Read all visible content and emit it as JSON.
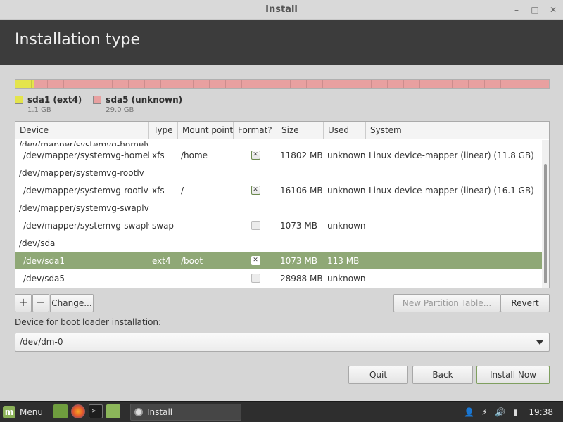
{
  "window": {
    "title": "Install",
    "page_title": "Installation type"
  },
  "partition_bar": {
    "segments": [
      {
        "name": "sda1 (ext4)",
        "size": "1.1 GB",
        "color": "#e4e44c",
        "fraction": 0.036
      },
      {
        "name": "sda5 (unknown)",
        "size": "29.0 GB",
        "color": "#e8a0a0",
        "fraction": 0.964
      }
    ]
  },
  "table": {
    "headers": {
      "device": "Device",
      "type": "Type",
      "mount": "Mount point",
      "format": "Format?",
      "size": "Size",
      "used": "Used",
      "system": "System"
    },
    "cut_row": "/dev/mapper/systemvg-homelv",
    "rows": [
      {
        "kind": "part",
        "device": "/dev/mapper/systemvg-homelv",
        "type": "xfs",
        "mount": "/home",
        "format": "checked",
        "size": "11802 MB",
        "used": "unknown",
        "system": "Linux device-mapper (linear) (11.8 GB)"
      },
      {
        "kind": "parent",
        "device": "/dev/mapper/systemvg-rootlv"
      },
      {
        "kind": "part",
        "device": "/dev/mapper/systemvg-rootlv",
        "type": "xfs",
        "mount": "/",
        "format": "checked",
        "size": "16106 MB",
        "used": "unknown",
        "system": "Linux device-mapper (linear) (16.1 GB)"
      },
      {
        "kind": "parent",
        "device": "/dev/mapper/systemvg-swaplv"
      },
      {
        "kind": "part",
        "device": "/dev/mapper/systemvg-swaplv",
        "type": "swap",
        "mount": "",
        "format": "unchecked",
        "size": "1073 MB",
        "used": "unknown",
        "system": ""
      },
      {
        "kind": "parent",
        "device": "/dev/sda"
      },
      {
        "kind": "part",
        "selected": true,
        "device": "/dev/sda1",
        "type": "ext4",
        "mount": "/boot",
        "format": "checked",
        "size": "1073 MB",
        "used": "113 MB",
        "system": ""
      },
      {
        "kind": "part",
        "device": "/dev/sda5",
        "type": "",
        "mount": "",
        "format": "unchecked",
        "size": "28988 MB",
        "used": "unknown",
        "system": ""
      }
    ]
  },
  "toolbar": {
    "add": "+",
    "remove": "−",
    "change": "Change...",
    "new_table": "New Partition Table...",
    "revert": "Revert"
  },
  "boot_loader": {
    "label": "Device for boot loader installation:",
    "value": "/dev/dm-0"
  },
  "buttons": {
    "quit": "Quit",
    "back": "Back",
    "install": "Install Now"
  },
  "taskbar": {
    "menu": "Menu",
    "task": "Install",
    "time": "19:38"
  }
}
